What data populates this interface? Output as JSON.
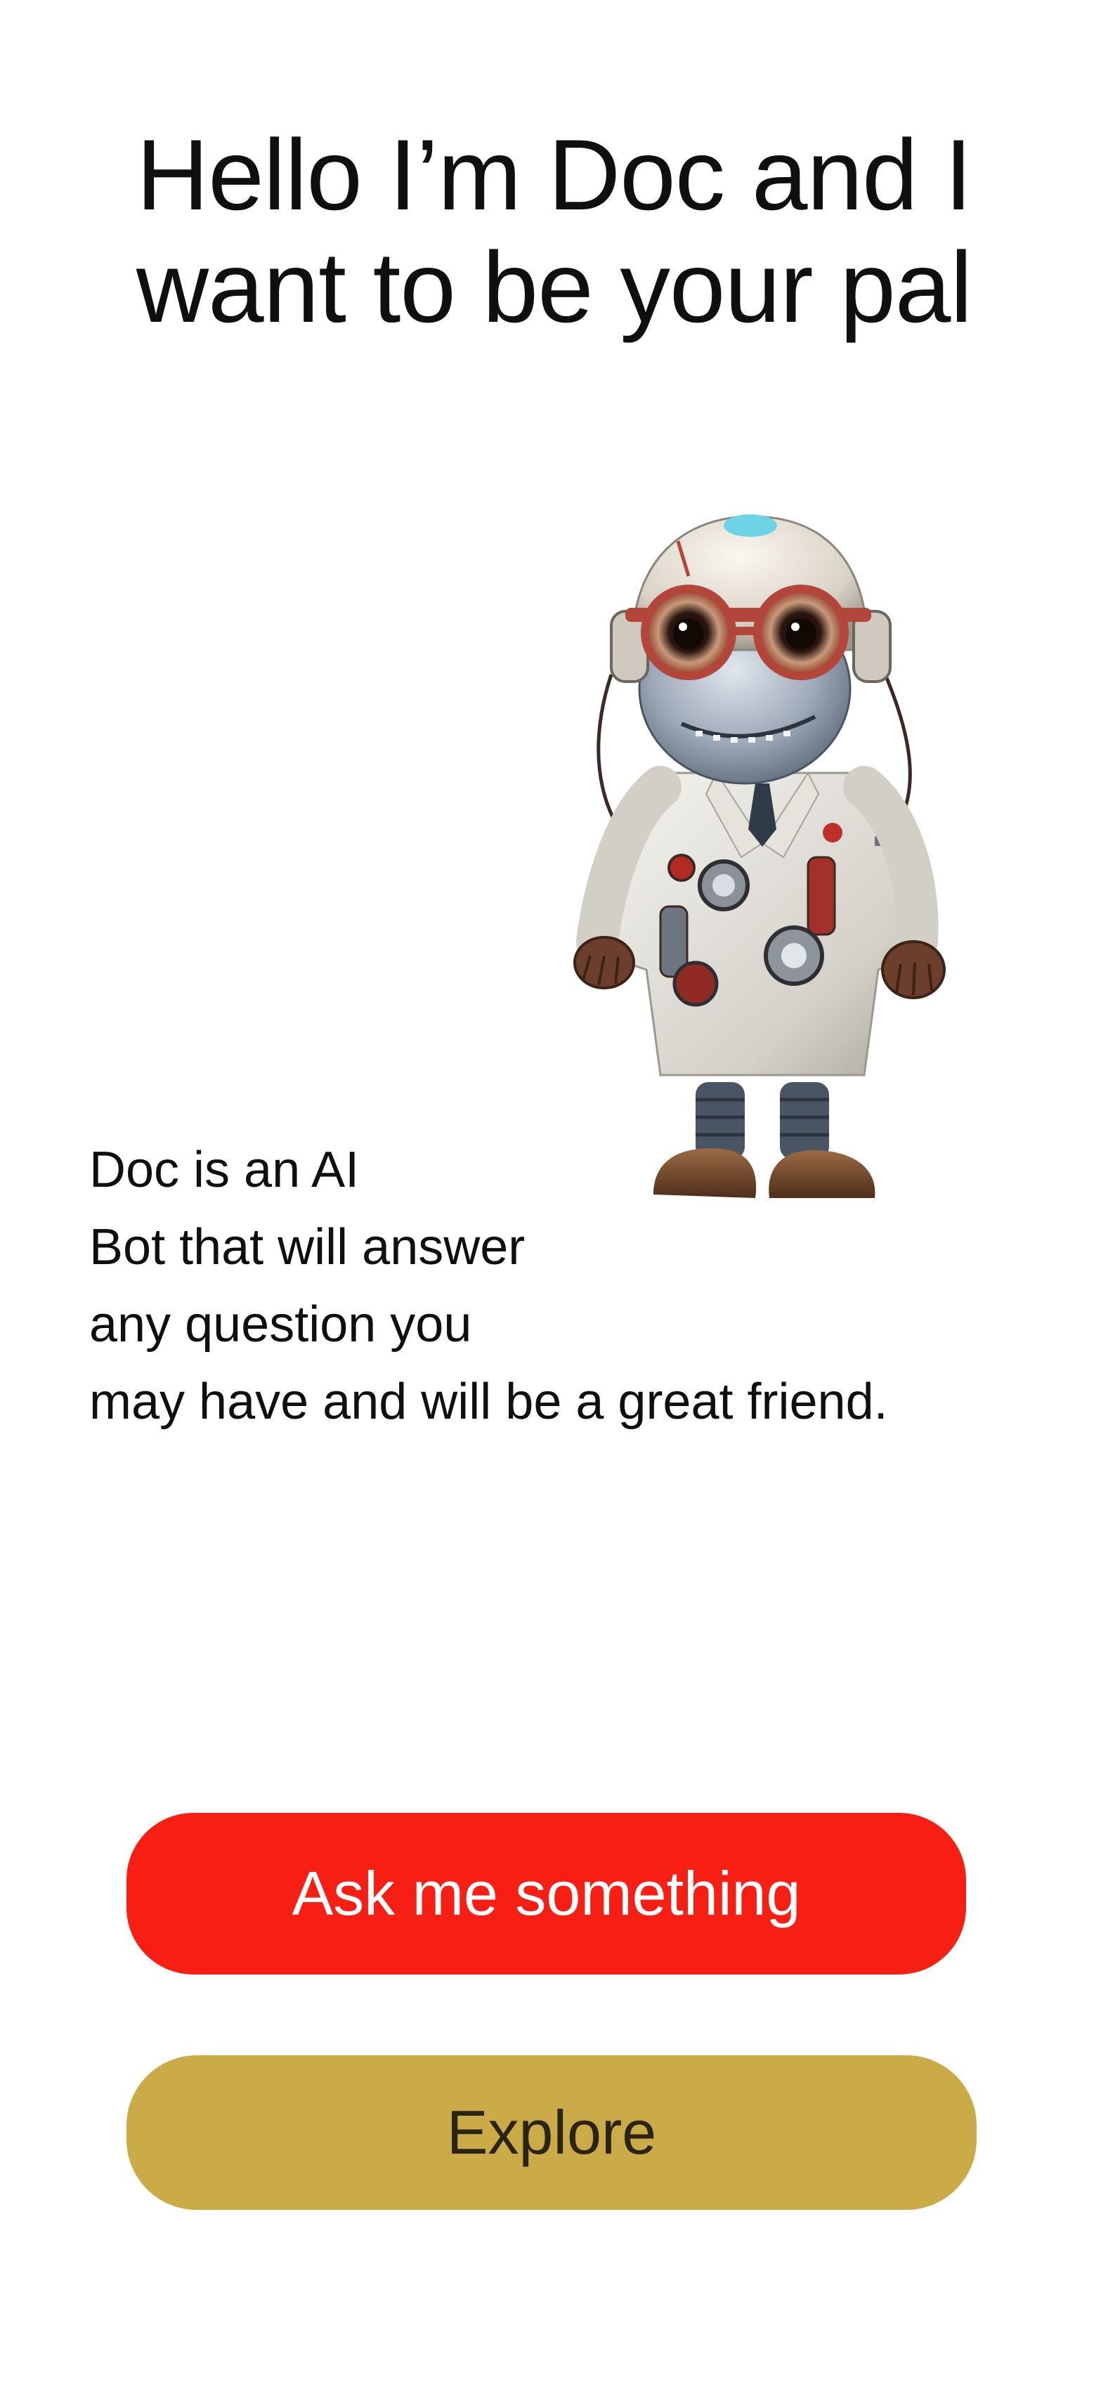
{
  "header": {
    "title_line1": "Hello I’m Doc and I",
    "title_line2": "want to be your pal"
  },
  "mascot": {
    "icon": "robot-doctor-mascot-icon"
  },
  "description": {
    "line1": "Doc is an AI",
    "line2": "Bot that will answer",
    "line3": "any question you",
    "line4": "may have and will be a great friend."
  },
  "actions": {
    "ask_label": "Ask me something",
    "explore_label": "Explore"
  },
  "colors": {
    "primary": "#f71f14",
    "secondary": "#cbab48",
    "background": "#ffffff"
  }
}
